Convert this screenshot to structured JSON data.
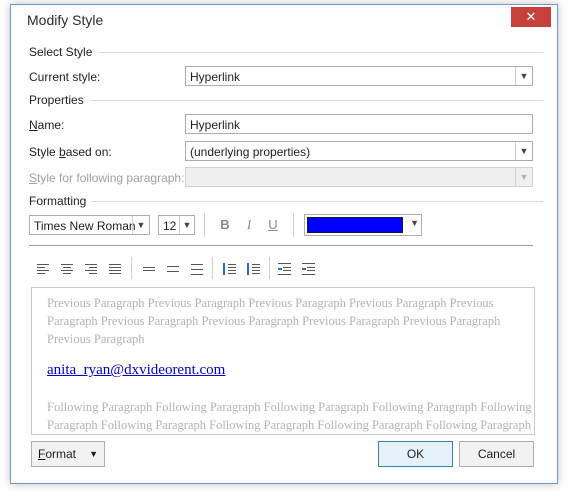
{
  "window": {
    "title": "Modify Style",
    "close_glyph": "✕"
  },
  "select_style": {
    "section": "Select Style",
    "current_style_label": "Current style:",
    "current_style_value": "Hyperlink"
  },
  "properties": {
    "section": "Properties",
    "name_label_u": "N",
    "name_label_rest": "ame:",
    "name_value": "Hyperlink",
    "based_on_label_a": "Style ",
    "based_on_label_u": "b",
    "based_on_label_b": "ased on:",
    "based_on_value": "(underlying properties)",
    "following_label_u": "S",
    "following_label_rest": "tyle for following paragraph:",
    "following_value": ""
  },
  "formatting": {
    "section": "Formatting",
    "font_family": "Times New Roman",
    "font_size": "12",
    "bold_glyph": "B",
    "italic_glyph": "I",
    "underline_glyph": "U",
    "font_color": "#0000ff"
  },
  "preview": {
    "previous_text": "Previous Paragraph Previous Paragraph Previous Paragraph Previous Paragraph Previous Paragraph Previous Paragraph Previous Paragraph Previous Paragraph Previous Paragraph Previous Paragraph",
    "sample_text": "anita_ryan@dxvideorent.com",
    "following_text": "Following Paragraph Following Paragraph Following Paragraph Following Paragraph Following Paragraph Following Paragraph Following Paragraph Following Paragraph Following Paragraph"
  },
  "buttons": {
    "format_label_u": "F",
    "format_label_rest": "ormat",
    "format_arrow": "▼",
    "ok": "OK",
    "cancel": "Cancel"
  },
  "colors": {
    "accent": "#3c7fb1",
    "close": "#c7413c",
    "link": "#0000cc"
  }
}
